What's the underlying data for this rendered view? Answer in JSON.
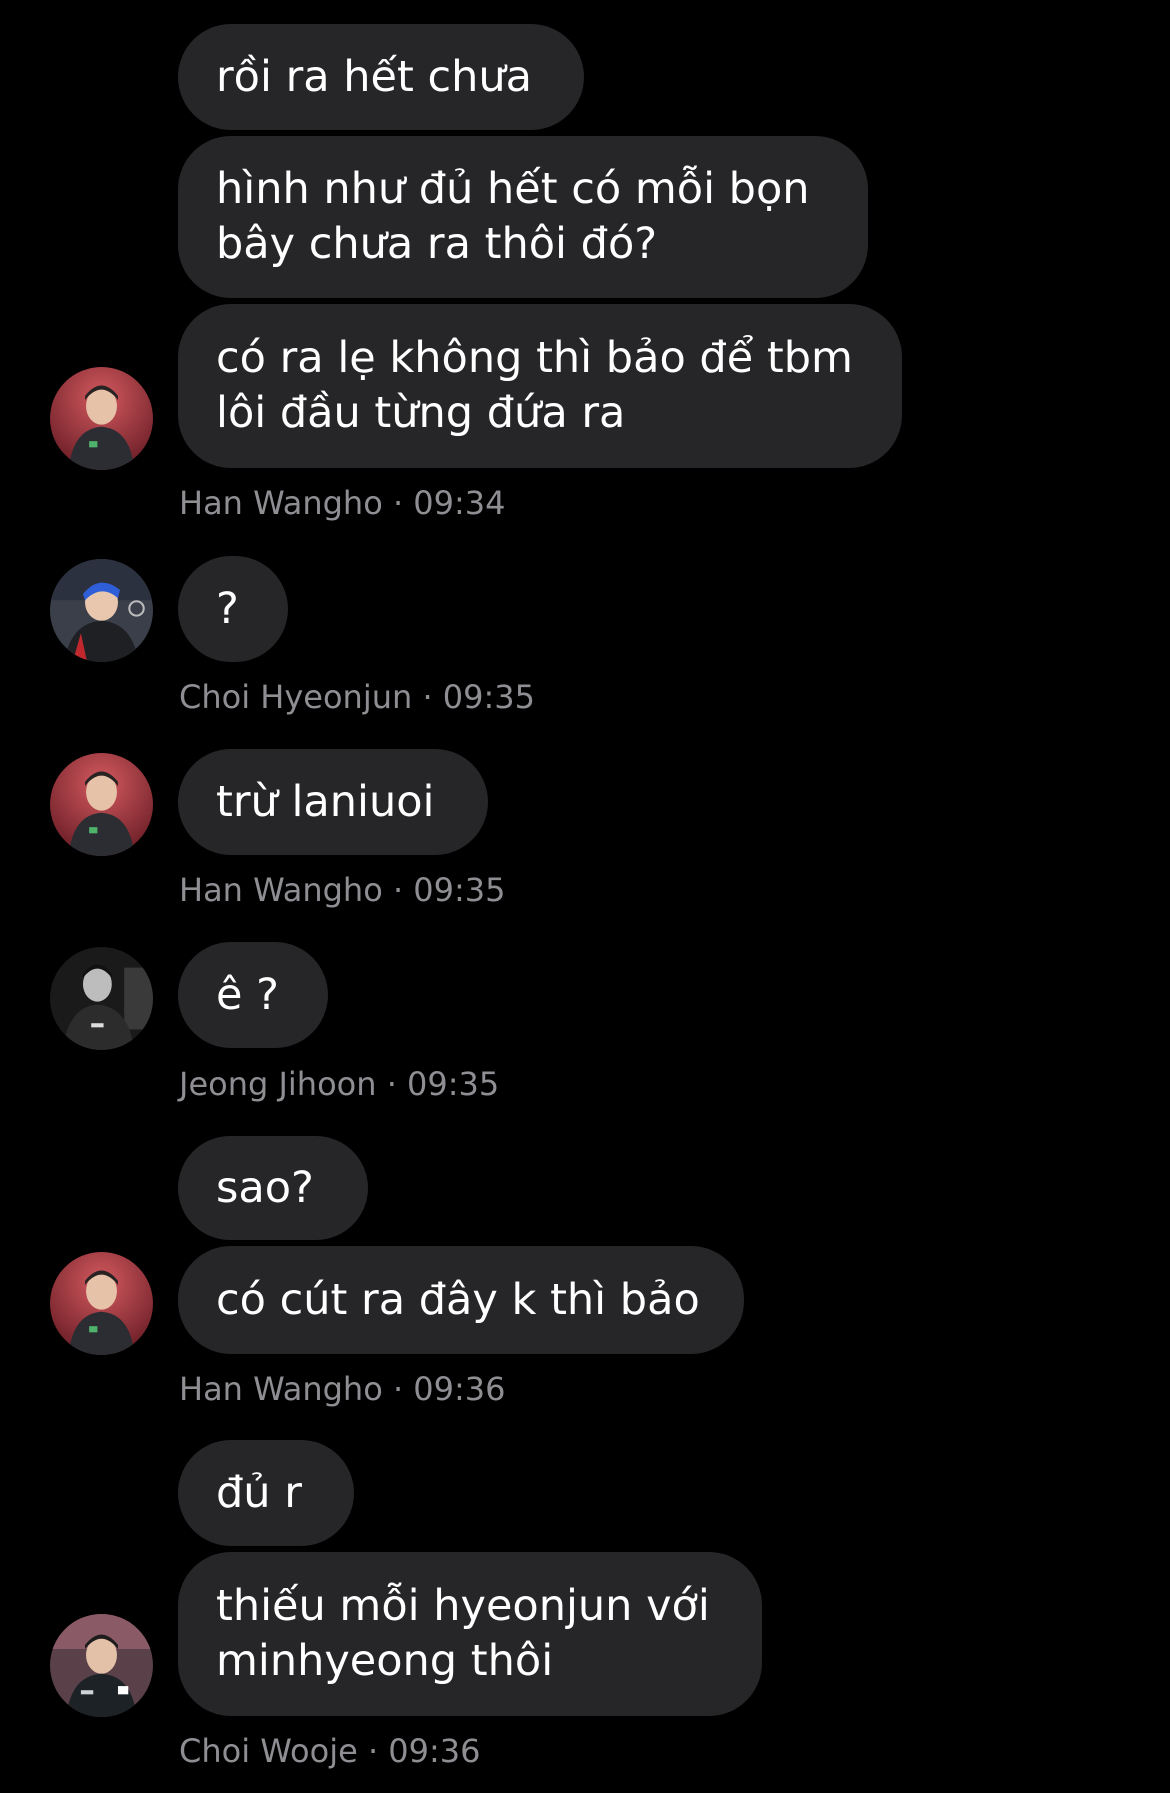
{
  "conversation": {
    "groups": [
      {
        "sender": "Han Wangho",
        "time": "09:34",
        "meta": "Han Wangho · 09:34",
        "avatar_icon": "avatar-han-wangho",
        "messages": [
          "rồi ra hết chưa",
          "hình như đủ hết có mỗi bọn\nbây chưa ra thôi đó?",
          "có ra lẹ không thì bảo để tbm\nlôi đầu từng đứa ra"
        ]
      },
      {
        "sender": "Choi Hyeonjun",
        "time": "09:35",
        "meta": "Choi Hyeonjun · 09:35",
        "avatar_icon": "avatar-choi-hyeonjun",
        "messages": [
          "?"
        ]
      },
      {
        "sender": "Han Wangho",
        "time": "09:35",
        "meta": "Han Wangho · 09:35",
        "avatar_icon": "avatar-han-wangho",
        "messages": [
          "trừ laniuoi"
        ]
      },
      {
        "sender": "Jeong Jihoon",
        "time": "09:35",
        "meta": "Jeong Jihoon · 09:35",
        "avatar_icon": "avatar-jeong-jihoon",
        "messages": [
          "ê ?"
        ]
      },
      {
        "sender": "Han Wangho",
        "time": "09:36",
        "meta": "Han Wangho · 09:36",
        "avatar_icon": "avatar-han-wangho",
        "messages": [
          "sao?",
          "có cút ra đây k thì bảo"
        ]
      },
      {
        "sender": "Choi Wooje",
        "time": "09:36",
        "meta": "Choi Wooje · 09:36",
        "avatar_icon": "avatar-choi-wooje",
        "messages": [
          "đủ r",
          "thiếu mỗi hyeonjun với\nminhyeong thôi"
        ]
      }
    ]
  },
  "colors": {
    "background": "#000000",
    "bubble": "#262628",
    "bubble_text": "#ffffff",
    "meta_text": "#8e8e93"
  }
}
